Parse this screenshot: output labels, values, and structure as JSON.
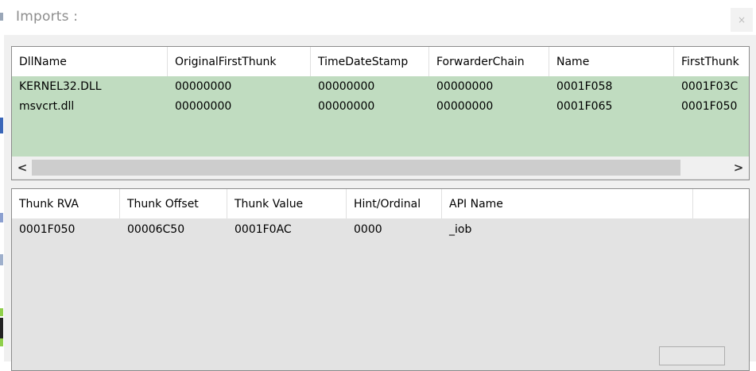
{
  "window": {
    "title": "Imports :",
    "close_glyph": "×"
  },
  "top_table": {
    "columns": [
      "DllName",
      "OriginalFirstThunk",
      "TimeDateStamp",
      "ForwarderChain",
      "Name",
      "FirstThunk"
    ],
    "rows": [
      [
        "KERNEL32.DLL",
        "00000000",
        "00000000",
        "00000000",
        "0001F058",
        "0001F03C"
      ],
      [
        "msvcrt.dll",
        "00000000",
        "00000000",
        "00000000",
        "0001F065",
        "0001F050"
      ]
    ],
    "selected_row_color": "#c0dcc0",
    "scroll_left_glyph": "<",
    "scroll_right_glyph": ">"
  },
  "bottom_table": {
    "columns": [
      "Thunk RVA",
      "Thunk Offset",
      "Thunk Value",
      "Hint/Ordinal",
      "API Name"
    ],
    "rows": [
      [
        "0001F050",
        "00006C50",
        "0001F0AC",
        "0000",
        "_iob"
      ]
    ]
  }
}
